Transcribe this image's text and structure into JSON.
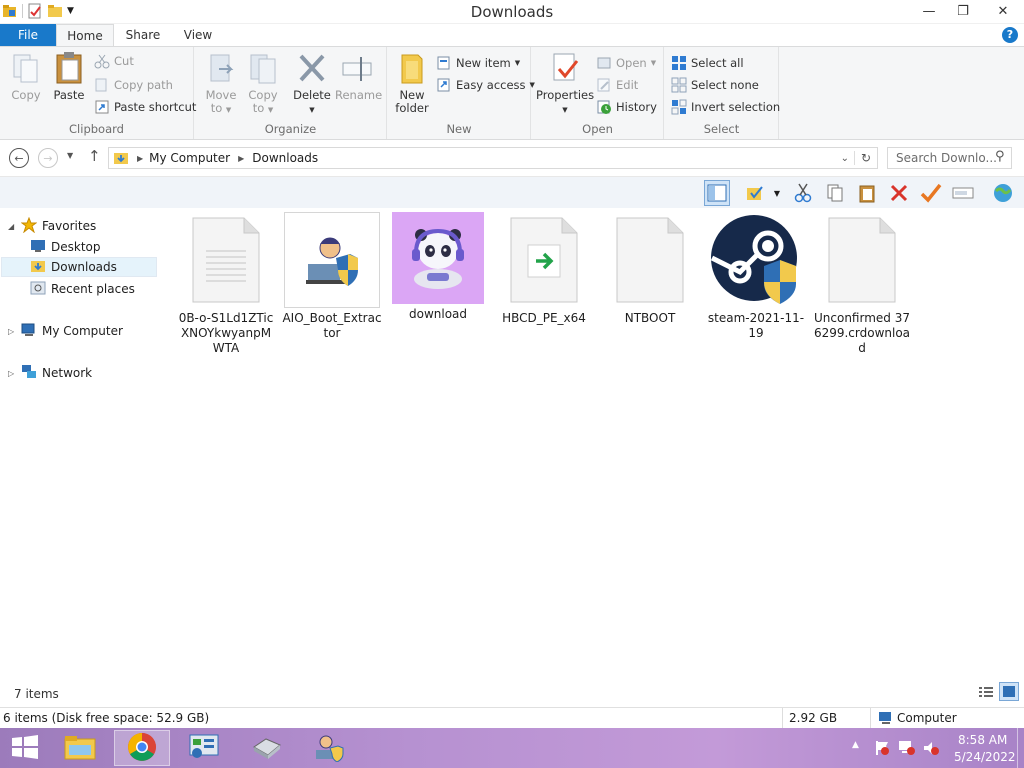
{
  "window": {
    "title": "Downloads",
    "minimize": "—",
    "restore": "❐",
    "close": "✕"
  },
  "tabs": {
    "file": "File",
    "home": "Home",
    "share": "Share",
    "view": "View",
    "help": "?"
  },
  "ribbon": {
    "clipboard": {
      "label": "Clipboard",
      "copy": "Copy",
      "paste": "Paste",
      "cut": "Cut",
      "copy_path": "Copy path",
      "paste_shortcut": "Paste shortcut"
    },
    "organize": {
      "label": "Organize",
      "move_to_1": "Move",
      "move_to_2": "to",
      "copy_to_1": "Copy",
      "copy_to_2": "to",
      "delete": "Delete",
      "rename": "Rename"
    },
    "new": {
      "label": "New",
      "new_folder_1": "New",
      "new_folder_2": "folder",
      "new_item": "New item",
      "easy_access": "Easy access"
    },
    "open": {
      "label": "Open",
      "properties": "Properties",
      "open": "Open",
      "edit": "Edit",
      "history": "History"
    },
    "select": {
      "label": "Select",
      "select_all": "Select all",
      "select_none": "Select none",
      "invert": "Invert selection"
    }
  },
  "address": {
    "path": [
      "My Computer",
      "Downloads"
    ],
    "search_placeholder": "Search Downlo..."
  },
  "nav": {
    "favorites": "Favorites",
    "desktop": "Desktop",
    "downloads": "Downloads",
    "recent": "Recent places",
    "computer": "My Computer",
    "network": "Network"
  },
  "files": [
    {
      "name": "0B-o-S1Ld1ZTicXNOYkwyanpMWTA",
      "icon": "text-document-icon"
    },
    {
      "name": "AIO_Boot_Extractor",
      "icon": "app-shield-icon"
    },
    {
      "name": "download",
      "icon": "panda-image-icon"
    },
    {
      "name": "HBCD_PE_x64",
      "icon": "shortcut-document-icon"
    },
    {
      "name": "NTBOOT",
      "icon": "blank-document-icon"
    },
    {
      "name": "steam-2021-11-19",
      "icon": "steam-shield-icon"
    },
    {
      "name": "Unconfirmed 376299.crdownload",
      "icon": "blank-document-icon"
    }
  ],
  "status": {
    "items": "7 items",
    "selection": "6 items (Disk free space: 52.9 GB)",
    "size": "2.92 GB",
    "location": "Computer"
  },
  "taskbar": {
    "time": "8:58 AM",
    "date": "5/24/2022"
  },
  "colors": {
    "accent": "#1979ca",
    "taskbar": "#b691d1"
  }
}
